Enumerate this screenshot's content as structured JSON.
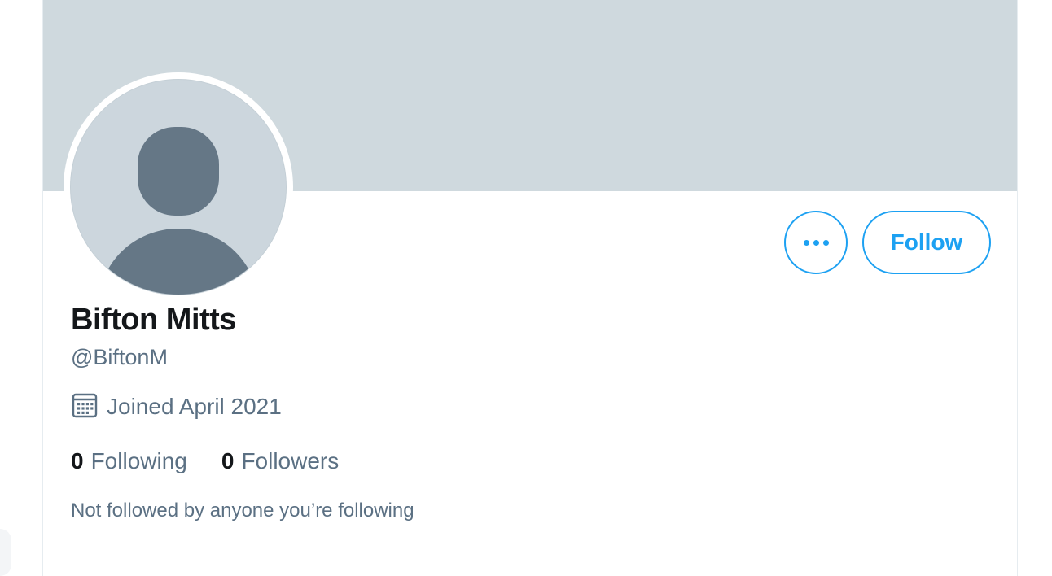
{
  "profile": {
    "display_name": "Bifton Mitts",
    "handle": "@BiftonM",
    "joined": "Joined April 2021",
    "following_count": "0",
    "following_label": "Following",
    "followers_count": "0",
    "followers_label": "Followers",
    "not_followed_note": "Not followed by anyone you’re following"
  },
  "actions": {
    "follow_label": "Follow",
    "more_icon": "more-horizontal-icon"
  },
  "icons": {
    "joined": "calendar-icon",
    "avatar": "default-avatar-silhouette-icon"
  },
  "colors": {
    "accent": "#1da1f2",
    "banner": "#cfd9de",
    "avatar_bg": "#ccd6dd",
    "avatar_figure": "#657786",
    "primary_text": "#14171a",
    "secondary_text": "#5b7083"
  }
}
